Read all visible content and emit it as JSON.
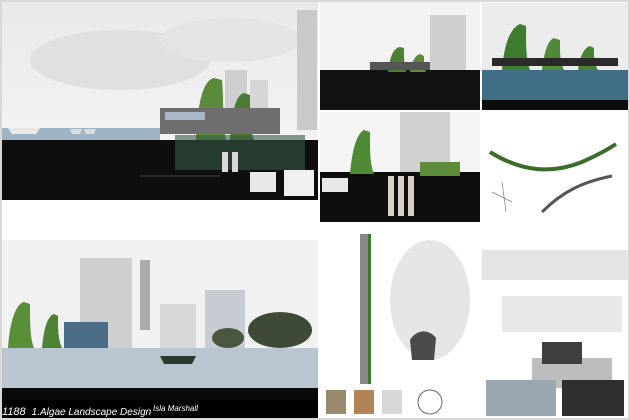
{
  "board": {
    "entry_number": "1188",
    "title": "1.Algae Landscape Design",
    "author": "Isla Marshall"
  },
  "panels": [
    {
      "name": "section-elevation-panel"
    },
    {
      "name": "model-photo-panel"
    },
    {
      "name": "context-render-panel"
    },
    {
      "name": "section-detail-panel"
    },
    {
      "name": "sketch-diagram-panel"
    },
    {
      "name": "riverside-perspective-panel"
    },
    {
      "name": "wall-section-panel"
    },
    {
      "name": "site-photos-panel"
    }
  ]
}
